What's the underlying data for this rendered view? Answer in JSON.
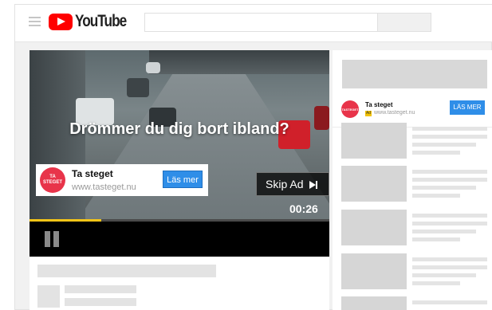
{
  "header": {
    "logo_text": "YouTube",
    "menu_icon": "hamburger-menu-icon",
    "logo_icon": "youtube-play-icon"
  },
  "video": {
    "headline": "Drömmer du dig bort ibland?",
    "ad": {
      "logo_text_line1": "TA",
      "logo_text_line2": "STEGET",
      "title": "Ta steget",
      "url": "www.tasteget.nu",
      "button_label": "Läs mer"
    },
    "skip_label": "Skip Ad",
    "skip_icon": "skip-next-icon",
    "timer": "00:26",
    "progress": 0.24,
    "pause_icon": "pause-icon"
  },
  "companion": {
    "logo_text_line1": "TA",
    "logo_text_line2": "STEGET",
    "title": "Ta steget",
    "ad_badge": "Ad",
    "url": "www.tasteget.nu",
    "button_label": "LÄS MER"
  },
  "colors": {
    "brand_red": "#ff0000",
    "ad_logo": "#e8344a",
    "cta_blue": "#2f8ee8",
    "progress": "#f5c518"
  }
}
